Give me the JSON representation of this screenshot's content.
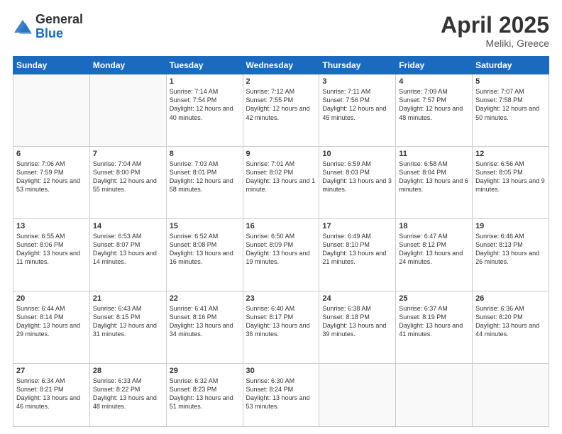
{
  "header": {
    "logo_general": "General",
    "logo_blue": "Blue",
    "month_title": "April 2025",
    "location": "Meliki, Greece"
  },
  "days_of_week": [
    "Sunday",
    "Monday",
    "Tuesday",
    "Wednesday",
    "Thursday",
    "Friday",
    "Saturday"
  ],
  "weeks": [
    [
      {
        "day": "",
        "sunrise": "",
        "sunset": "",
        "daylight": ""
      },
      {
        "day": "",
        "sunrise": "",
        "sunset": "",
        "daylight": ""
      },
      {
        "day": "1",
        "sunrise": "Sunrise: 7:14 AM",
        "sunset": "Sunset: 7:54 PM",
        "daylight": "Daylight: 12 hours and 40 minutes."
      },
      {
        "day": "2",
        "sunrise": "Sunrise: 7:12 AM",
        "sunset": "Sunset: 7:55 PM",
        "daylight": "Daylight: 12 hours and 42 minutes."
      },
      {
        "day": "3",
        "sunrise": "Sunrise: 7:11 AM",
        "sunset": "Sunset: 7:56 PM",
        "daylight": "Daylight: 12 hours and 45 minutes."
      },
      {
        "day": "4",
        "sunrise": "Sunrise: 7:09 AM",
        "sunset": "Sunset: 7:57 PM",
        "daylight": "Daylight: 12 hours and 48 minutes."
      },
      {
        "day": "5",
        "sunrise": "Sunrise: 7:07 AM",
        "sunset": "Sunset: 7:58 PM",
        "daylight": "Daylight: 12 hours and 50 minutes."
      }
    ],
    [
      {
        "day": "6",
        "sunrise": "Sunrise: 7:06 AM",
        "sunset": "Sunset: 7:59 PM",
        "daylight": "Daylight: 12 hours and 53 minutes."
      },
      {
        "day": "7",
        "sunrise": "Sunrise: 7:04 AM",
        "sunset": "Sunset: 8:00 PM",
        "daylight": "Daylight: 12 hours and 55 minutes."
      },
      {
        "day": "8",
        "sunrise": "Sunrise: 7:03 AM",
        "sunset": "Sunset: 8:01 PM",
        "daylight": "Daylight: 12 hours and 58 minutes."
      },
      {
        "day": "9",
        "sunrise": "Sunrise: 7:01 AM",
        "sunset": "Sunset: 8:02 PM",
        "daylight": "Daylight: 13 hours and 1 minute."
      },
      {
        "day": "10",
        "sunrise": "Sunrise: 6:59 AM",
        "sunset": "Sunset: 8:03 PM",
        "daylight": "Daylight: 13 hours and 3 minutes."
      },
      {
        "day": "11",
        "sunrise": "Sunrise: 6:58 AM",
        "sunset": "Sunset: 8:04 PM",
        "daylight": "Daylight: 13 hours and 6 minutes."
      },
      {
        "day": "12",
        "sunrise": "Sunrise: 6:56 AM",
        "sunset": "Sunset: 8:05 PM",
        "daylight": "Daylight: 13 hours and 9 minutes."
      }
    ],
    [
      {
        "day": "13",
        "sunrise": "Sunrise: 6:55 AM",
        "sunset": "Sunset: 8:06 PM",
        "daylight": "Daylight: 13 hours and 11 minutes."
      },
      {
        "day": "14",
        "sunrise": "Sunrise: 6:53 AM",
        "sunset": "Sunset: 8:07 PM",
        "daylight": "Daylight: 13 hours and 14 minutes."
      },
      {
        "day": "15",
        "sunrise": "Sunrise: 6:52 AM",
        "sunset": "Sunset: 8:08 PM",
        "daylight": "Daylight: 13 hours and 16 minutes."
      },
      {
        "day": "16",
        "sunrise": "Sunrise: 6:50 AM",
        "sunset": "Sunset: 8:09 PM",
        "daylight": "Daylight: 13 hours and 19 minutes."
      },
      {
        "day": "17",
        "sunrise": "Sunrise: 6:49 AM",
        "sunset": "Sunset: 8:10 PM",
        "daylight": "Daylight: 13 hours and 21 minutes."
      },
      {
        "day": "18",
        "sunrise": "Sunrise: 6:47 AM",
        "sunset": "Sunset: 8:12 PM",
        "daylight": "Daylight: 13 hours and 24 minutes."
      },
      {
        "day": "19",
        "sunrise": "Sunrise: 6:46 AM",
        "sunset": "Sunset: 8:13 PM",
        "daylight": "Daylight: 13 hours and 26 minutes."
      }
    ],
    [
      {
        "day": "20",
        "sunrise": "Sunrise: 6:44 AM",
        "sunset": "Sunset: 8:14 PM",
        "daylight": "Daylight: 13 hours and 29 minutes."
      },
      {
        "day": "21",
        "sunrise": "Sunrise: 6:43 AM",
        "sunset": "Sunset: 8:15 PM",
        "daylight": "Daylight: 13 hours and 31 minutes."
      },
      {
        "day": "22",
        "sunrise": "Sunrise: 6:41 AM",
        "sunset": "Sunset: 8:16 PM",
        "daylight": "Daylight: 13 hours and 34 minutes."
      },
      {
        "day": "23",
        "sunrise": "Sunrise: 6:40 AM",
        "sunset": "Sunset: 8:17 PM",
        "daylight": "Daylight: 13 hours and 36 minutes."
      },
      {
        "day": "24",
        "sunrise": "Sunrise: 6:38 AM",
        "sunset": "Sunset: 8:18 PM",
        "daylight": "Daylight: 13 hours and 39 minutes."
      },
      {
        "day": "25",
        "sunrise": "Sunrise: 6:37 AM",
        "sunset": "Sunset: 8:19 PM",
        "daylight": "Daylight: 13 hours and 41 minutes."
      },
      {
        "day": "26",
        "sunrise": "Sunrise: 6:36 AM",
        "sunset": "Sunset: 8:20 PM",
        "daylight": "Daylight: 13 hours and 44 minutes."
      }
    ],
    [
      {
        "day": "27",
        "sunrise": "Sunrise: 6:34 AM",
        "sunset": "Sunset: 8:21 PM",
        "daylight": "Daylight: 13 hours and 46 minutes."
      },
      {
        "day": "28",
        "sunrise": "Sunrise: 6:33 AM",
        "sunset": "Sunset: 8:22 PM",
        "daylight": "Daylight: 13 hours and 48 minutes."
      },
      {
        "day": "29",
        "sunrise": "Sunrise: 6:32 AM",
        "sunset": "Sunset: 8:23 PM",
        "daylight": "Daylight: 13 hours and 51 minutes."
      },
      {
        "day": "30",
        "sunrise": "Sunrise: 6:30 AM",
        "sunset": "Sunset: 8:24 PM",
        "daylight": "Daylight: 13 hours and 53 minutes."
      },
      {
        "day": "",
        "sunrise": "",
        "sunset": "",
        "daylight": ""
      },
      {
        "day": "",
        "sunrise": "",
        "sunset": "",
        "daylight": ""
      },
      {
        "day": "",
        "sunrise": "",
        "sunset": "",
        "daylight": ""
      }
    ]
  ]
}
